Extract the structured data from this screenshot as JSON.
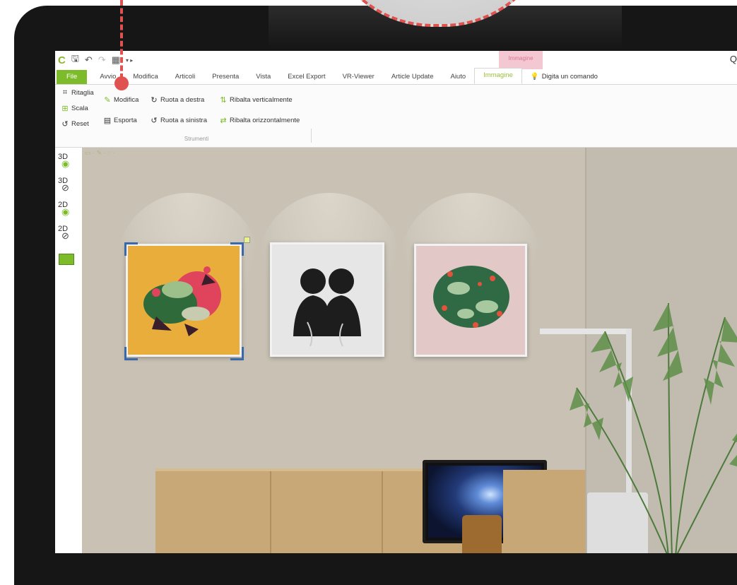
{
  "app": {
    "ribbon_tabs": [
      "Avvio",
      "Modifica",
      "Articoli",
      "Presenta",
      "Vista",
      "Excel Export",
      "VR-Viewer",
      "Article Update",
      "Aiuto"
    ],
    "file_tab": "File",
    "context_tab_header": "Immagine",
    "active_tab": "Immagine",
    "search_placeholder": "Digita un comando",
    "search_icon": "Q"
  },
  "ribbon": {
    "col1": [
      "Ritaglia",
      "Scala",
      "Reset"
    ],
    "modifica": "Modifica",
    "esporta": "Esporta",
    "ruota_destra": "Ruota a destra",
    "ruota_sinistra": "Ruota a sinistra",
    "ribalta_verticale": "Ribalta verticalmente",
    "ribalta_orizzontale": "Ribalta orizzontalmente",
    "group_label": "Strumenti"
  },
  "left_panel": {
    "items": [
      "3D",
      "3D",
      "2D",
      "2D"
    ]
  },
  "colors": {
    "accent": "#7dbb2a",
    "callout": "#e0524f",
    "selection": "#3a68a8"
  },
  "artworks": [
    "abstract-yellow",
    "silhouettes-bw",
    "abstract-pink"
  ]
}
